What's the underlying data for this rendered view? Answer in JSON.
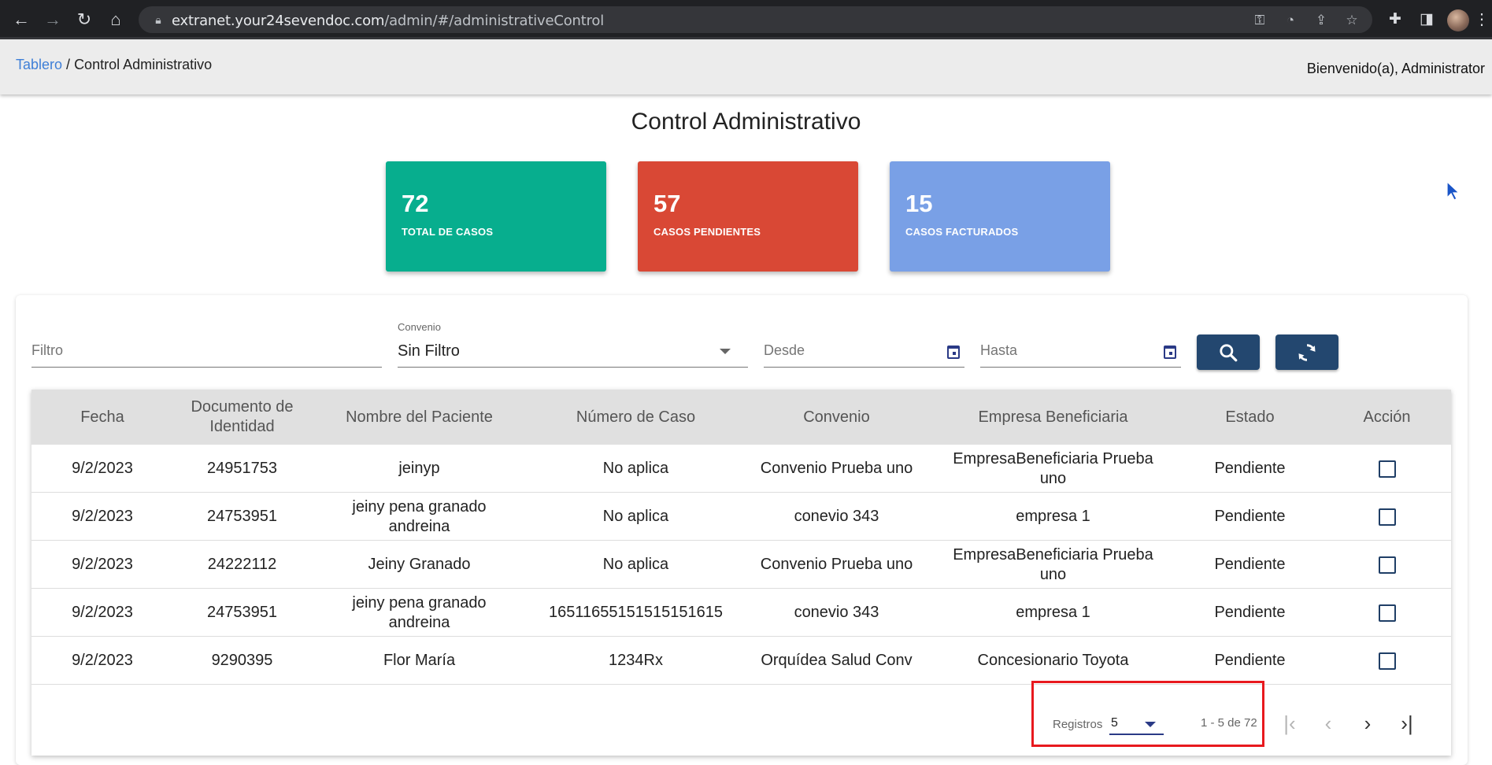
{
  "browser": {
    "url_host": "extranet.your24sevendoc.com",
    "url_path": "/admin/#/administrativeControl"
  },
  "breadcrumb": {
    "link": "Tablero",
    "separator": " / ",
    "current": "Control Administrativo"
  },
  "header": {
    "welcome": "Bienvenido(a), Administrator"
  },
  "page_title": "Control Administrativo",
  "stats": [
    {
      "value": "72",
      "label": "TOTAL DE CASOS",
      "color": "#07ae8e"
    },
    {
      "value": "57",
      "label": "CASOS PENDIENTES",
      "color": "#d94835"
    },
    {
      "value": "15",
      "label": "CASOS FACTURADOS",
      "color": "#79a0e6"
    }
  ],
  "filters": {
    "filtro_placeholder": "Filtro",
    "convenio_label": "Convenio",
    "convenio_value": "Sin Filtro",
    "desde_placeholder": "Desde",
    "hasta_placeholder": "Hasta"
  },
  "table": {
    "headers": [
      "Fecha",
      "Documento de Identidad",
      "Nombre del Paciente",
      "Número de Caso",
      "Convenio",
      "Empresa Beneficiaria",
      "Estado",
      "Acción"
    ],
    "rows": [
      [
        "9/2/2023",
        "24951753",
        "jeinyp",
        "No aplica",
        "Convenio Prueba uno",
        "EmpresaBeneficiaria Prueba uno",
        "Pendiente"
      ],
      [
        "9/2/2023",
        "24753951",
        "jeiny pena granado andreina",
        "No aplica",
        "conevio 343",
        "empresa 1",
        "Pendiente"
      ],
      [
        "9/2/2023",
        "24222112",
        "Jeiny Granado",
        "No aplica",
        "Convenio Prueba uno",
        "EmpresaBeneficiaria Prueba uno",
        "Pendiente"
      ],
      [
        "9/2/2023",
        "24753951",
        "jeiny pena granado andreina",
        "16511655151515151615",
        "conevio 343",
        "empresa 1",
        "Pendiente"
      ],
      [
        "9/2/2023",
        "9290395",
        "Flor María",
        "1234Rx",
        "Orquídea Salud Conv",
        "Concesionario Toyota",
        "Pendiente"
      ]
    ]
  },
  "pager": {
    "label": "Registros",
    "page_size": "5",
    "range": "1 - 5 de 72"
  }
}
